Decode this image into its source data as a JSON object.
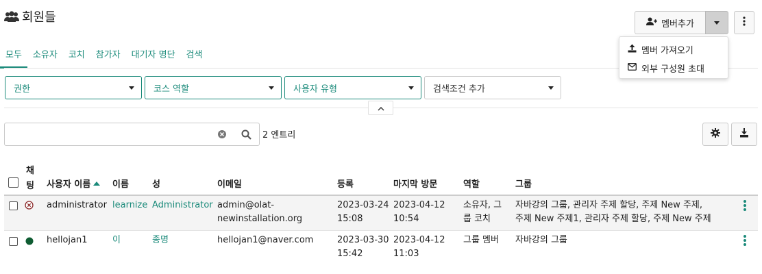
{
  "page": {
    "title": "회원들"
  },
  "toolbar": {
    "add_member_label": "멤버추가"
  },
  "dropdown": {
    "items": [
      {
        "label": "멤버 가져오기",
        "icon": "upload-icon"
      },
      {
        "label": "외부 구성원 초대",
        "icon": "envelope-icon"
      }
    ]
  },
  "tabs": [
    "모두",
    "소유자",
    "코치",
    "참가자",
    "대기자 명단",
    "검색"
  ],
  "filters": {
    "permission": "권한",
    "course_role": "코스 역할",
    "user_type": "사용자 유형",
    "add_criteria": "검색조건 추가"
  },
  "search": {
    "value": "",
    "entries": "2 엔트리"
  },
  "colors": {
    "accent": "#1a8a7a",
    "status_active": "#0f5c32",
    "status_pending": "#8c2b2b"
  },
  "table": {
    "headers": {
      "chat_line1": "채",
      "chat_line2": "팅",
      "username": "사용자 이름",
      "first_name": "이름",
      "last_name": "성",
      "email": "이메일",
      "registered": "등록",
      "last_visit": "마지막 방문",
      "role": "역할",
      "group": "그룹"
    },
    "rows": [
      {
        "username": "administrator",
        "first_name": "learnize",
        "last_name": "Administrator",
        "email_line1": "admin@olat-",
        "email_line2": "newinstallation.org",
        "registered_date": "2023-03-24",
        "registered_time": "15:08",
        "visit_date": "2023-04-12",
        "visit_time": "10:54",
        "role_line1": "소유자, 그",
        "role_line2": "룹 코치",
        "group_line1": "자바강의 그룹, 관리자 주제 할당, 주제 New 주제,",
        "group_line2": "주제 New 주제1, 관리자 주제 할당, 주제 New 주제"
      },
      {
        "username": "hellojan1",
        "first_name": "이",
        "last_name": "종명",
        "email_line1": "hellojan1@naver.com",
        "registered_date": "2023-03-30",
        "registered_time": "15:42",
        "visit_date": "2023-04-12",
        "visit_time": "11:03",
        "role_line1": "그룹 멤버",
        "group_line1": "자바강의 그룹"
      }
    ]
  }
}
